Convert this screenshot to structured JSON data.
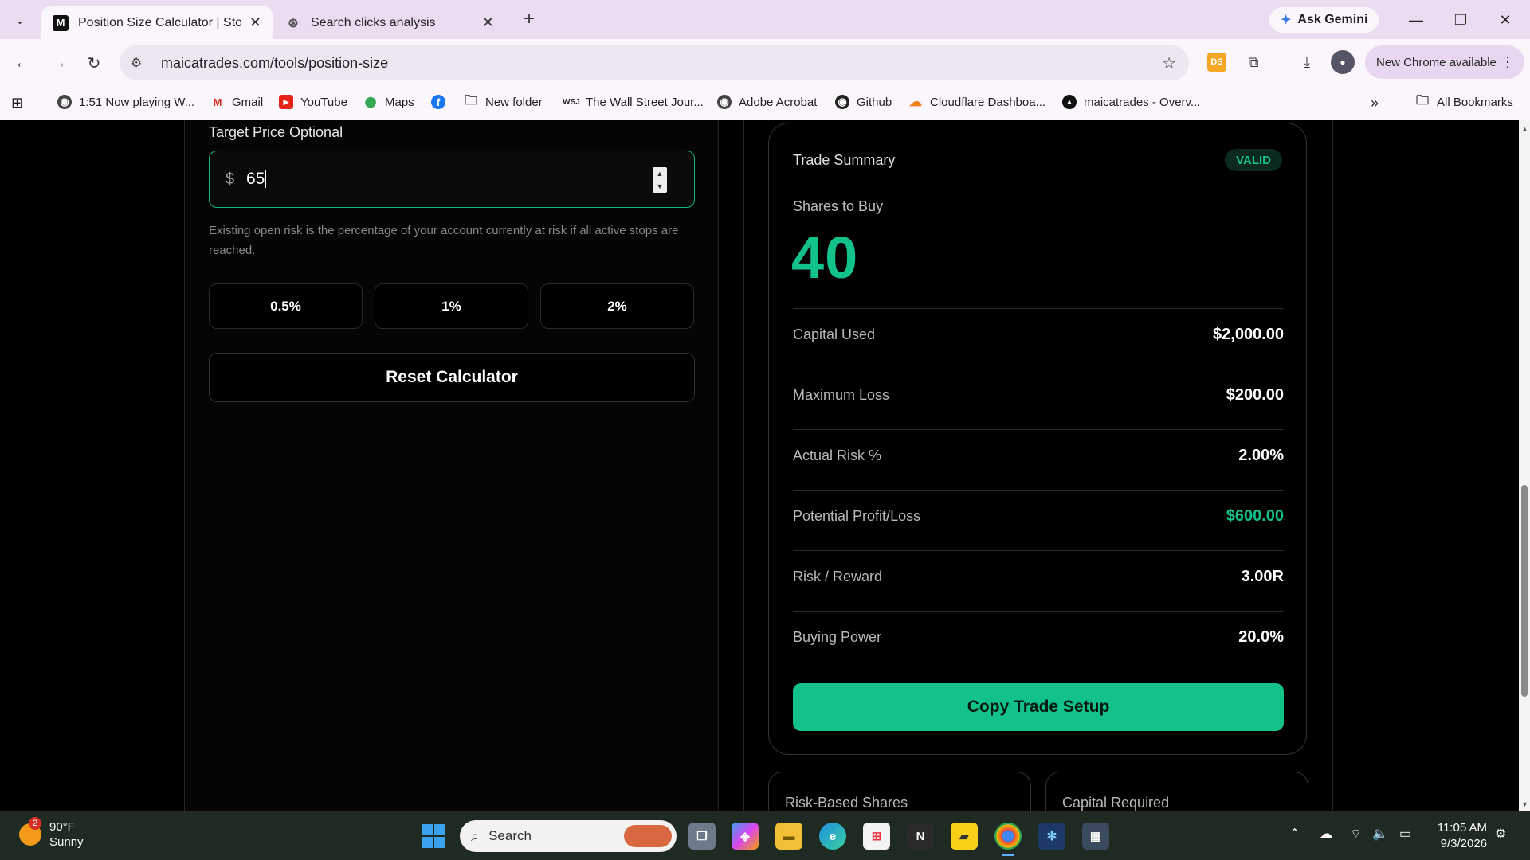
{
  "browser": {
    "tabs": [
      {
        "title": "Position Size Calculator | Stock I",
        "favicon": "M",
        "active": true
      },
      {
        "title": "Search clicks analysis",
        "favicon": "chatgpt-icon",
        "active": false
      }
    ],
    "gemini_label": "Ask Gemini",
    "url": "maicatrades.com/tools/position-size",
    "new_chrome_label": "New Chrome available",
    "ds_label": "DS",
    "bookmarks": [
      {
        "label": "1:51 Now playing W..."
      },
      {
        "label": "Gmail"
      },
      {
        "label": "YouTube"
      },
      {
        "label": "Maps"
      },
      {
        "label": ""
      },
      {
        "label": "New folder"
      },
      {
        "label": "The Wall Street Jour..."
      },
      {
        "label": "Adobe Acrobat"
      },
      {
        "label": "Github"
      },
      {
        "label": "Cloudflare Dashboa..."
      },
      {
        "label": "maicatrades - Overv..."
      }
    ],
    "all_bookmarks_label": "All Bookmarks",
    "overflow_label": "»"
  },
  "calculator": {
    "target_label": "Target Price Optional",
    "currency_symbol": "$",
    "target_value": "65",
    "helper_text": "Existing open risk is the percentage of your account currently at risk if all active stops are reached.",
    "risk_presets": [
      "0.5%",
      "1%",
      "2%"
    ],
    "reset_label": "Reset Calculator"
  },
  "summary": {
    "title": "Trade Summary",
    "status_badge": "VALID",
    "shares_label": "Shares to Buy",
    "shares_value": "40",
    "metrics": [
      {
        "label": "Capital Used",
        "value": "$2,000.00"
      },
      {
        "label": "Maximum Loss",
        "value": "$200.00"
      },
      {
        "label": "Actual Risk %",
        "value": "2.00%"
      },
      {
        "label": "Potential Profit/Loss",
        "value": "$600.00"
      },
      {
        "label": "Risk / Reward",
        "value": "3.00R"
      },
      {
        "label": "Buying Power",
        "value": "20.0%"
      }
    ],
    "copy_label": "Copy Trade Setup",
    "cards": [
      "Risk-Based Shares",
      "Capital Required"
    ],
    "accent_color": "#12c28a"
  },
  "taskbar": {
    "weather_badge": "2",
    "temperature": "90°F",
    "condition": "Sunny",
    "search_placeholder": "Search",
    "time": "11:05 AM",
    "date": "9/3/2026"
  }
}
